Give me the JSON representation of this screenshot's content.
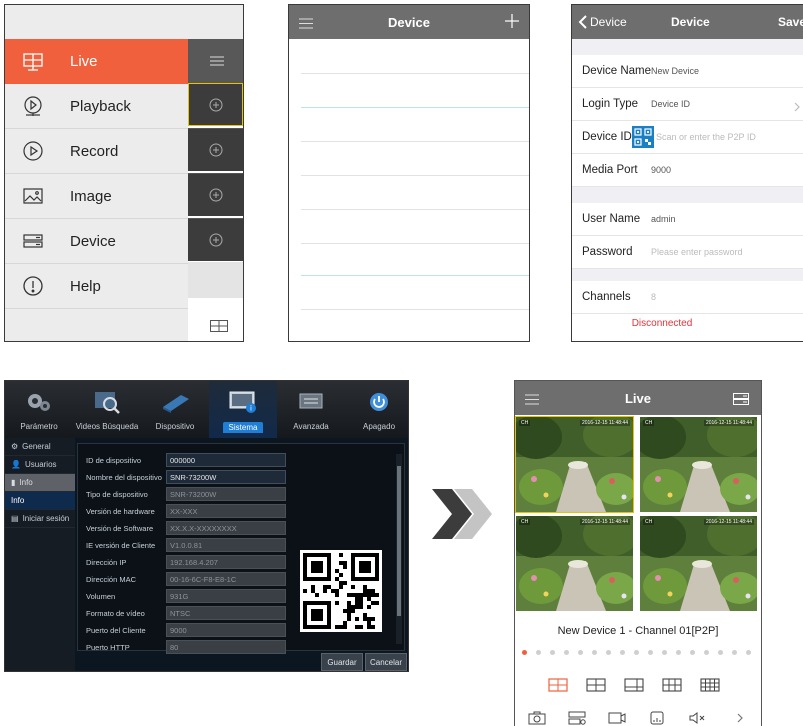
{
  "panel_menu": {
    "items": [
      {
        "label": "Live",
        "icon": "live-monitor-icon",
        "active": true
      },
      {
        "label": "Playback",
        "icon": "playback-icon",
        "active": false
      },
      {
        "label": "Record",
        "icon": "record-icon",
        "active": false
      },
      {
        "label": "Image",
        "icon": "image-icon",
        "active": false
      },
      {
        "label": "Device",
        "icon": "device-icon",
        "active": false
      },
      {
        "label": "Help",
        "icon": "help-icon",
        "active": false
      }
    ],
    "accent": "#f0603c"
  },
  "panel_list": {
    "title": "Device",
    "menu_icon": "hamburger-icon",
    "add_icon": "plus-icon"
  },
  "panel_form": {
    "back_label": "Device",
    "title": "Device",
    "save_label": "Save",
    "fields": [
      {
        "key": "Device Name",
        "value": "New Device",
        "placeholder": false
      },
      {
        "key": "Login Type",
        "value": "Device ID",
        "placeholder": false
      },
      {
        "key": "Device ID",
        "value": "Scan or enter the P2P ID",
        "placeholder": true
      },
      {
        "key": "Media Port",
        "value": "9000",
        "placeholder": false
      },
      {
        "key": "User Name",
        "value": "admin",
        "placeholder": false
      },
      {
        "key": "Password",
        "value": "Please enter password",
        "placeholder": true
      },
      {
        "key": "Channels",
        "value": "8",
        "placeholder": true
      }
    ],
    "status": "Disconnected",
    "status_color": "#e0333a"
  },
  "panel_dvr": {
    "tabs": [
      {
        "label": "Parámetro",
        "icon": "gears-icon"
      },
      {
        "label": "Videos Búsqueda",
        "icon": "video-search-icon"
      },
      {
        "label": "Dispositivo",
        "icon": "hard-disk-icon"
      },
      {
        "label": "Sistema",
        "icon": "system-monitor-icon",
        "active": true
      },
      {
        "label": "Avanzada",
        "icon": "advanced-icon"
      },
      {
        "label": "Apagado",
        "icon": "power-icon"
      }
    ],
    "side_items": [
      {
        "label": "General"
      },
      {
        "label": "Usuarios"
      },
      {
        "label": "Info"
      },
      {
        "label": "Info"
      },
      {
        "label": "Iniciar sesión"
      }
    ],
    "fields": [
      {
        "key": "ID de dispositivo",
        "value": "000000"
      },
      {
        "key": "Nombre del dispositivo",
        "value": "SNR-73200W"
      },
      {
        "key": "Tipo de dispositivo",
        "value": "SNR-73200W"
      },
      {
        "key": "Versión de hardware",
        "value": "XX-XXX"
      },
      {
        "key": "Versión de Software",
        "value": "XX.X.X-XXXXXXXX"
      },
      {
        "key": "IE versión de Cliente",
        "value": "V1.0.0.81"
      },
      {
        "key": "Dirección IP",
        "value": "192.168.4.207"
      },
      {
        "key": "Dirección MAC",
        "value": "00-16-6C-F8-E8-1C"
      },
      {
        "key": "Volumen",
        "value": "931G"
      },
      {
        "key": "Formato de vídeo",
        "value": "NTSC"
      },
      {
        "key": "Puerto del Cliente",
        "value": "9000"
      },
      {
        "key": "Puerto HTTP",
        "value": "80"
      }
    ],
    "save_label": "Guardar",
    "cancel_label": "Cancelar"
  },
  "arrow_icon": "double-chevron-right-icon",
  "panel_live": {
    "title": "Live",
    "timestamp": "2016-12-15 11:48:44",
    "cam_label": "CH",
    "status": "New Device 1 - Channel 01[P2P]",
    "page_dots": 17,
    "active_dot": 0
  }
}
